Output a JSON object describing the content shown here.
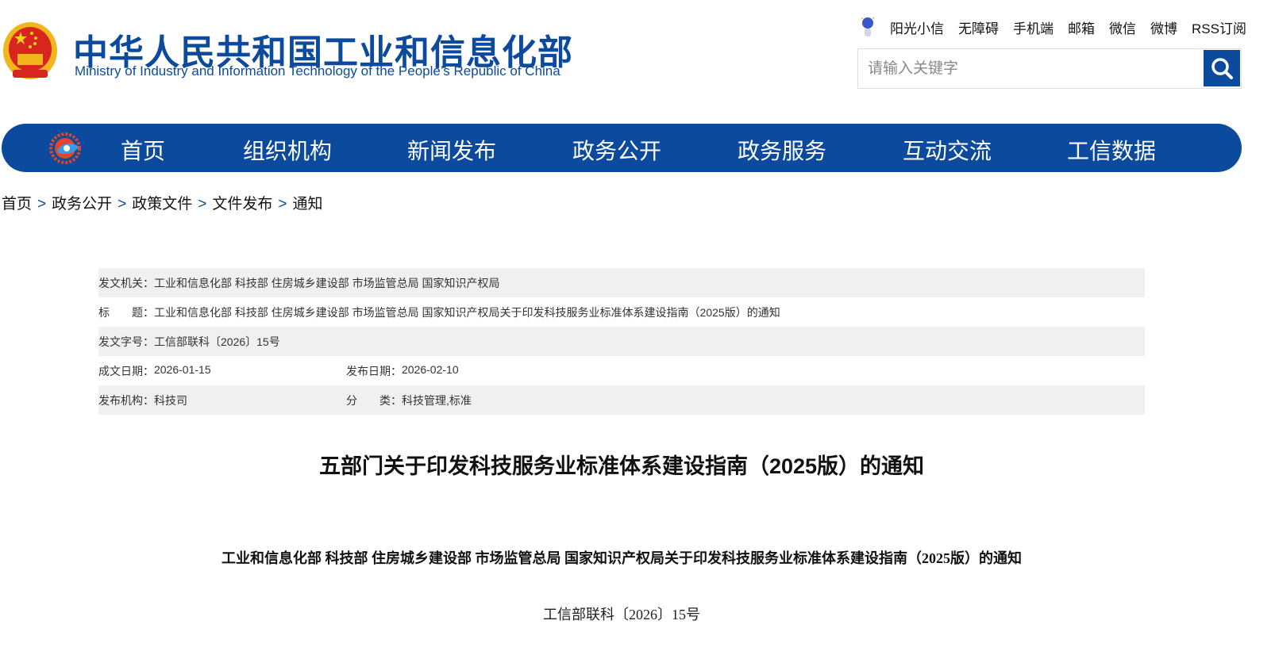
{
  "header": {
    "site_name_cn": "中华人民共和国工业和信息化部",
    "site_name_en": "Ministry of Industry and Information Technology of the People’s Republic of China",
    "top_links": [
      "阳光小信",
      "无障碍",
      "手机端",
      "邮箱",
      "微信",
      "微博",
      "RSS订阅"
    ],
    "search_placeholder": "请输入关键字"
  },
  "nav": {
    "items": [
      "首页",
      "组织机构",
      "新闻发布",
      "政务公开",
      "政务服务",
      "互动交流",
      "工信数据"
    ]
  },
  "breadcrumb": [
    "首页",
    "政务公开",
    "政策文件",
    "文件发布",
    "通知"
  ],
  "breadcrumb_sep": ">",
  "meta": {
    "issuer_label": "发文机关：",
    "issuer": "工业和信息化部 科技部 住房城乡建设部 市场监管总局 国家知识产权局",
    "title_label": "标　　题：",
    "title": "工业和信息化部 科技部 住房城乡建设部 市场监管总局 国家知识产权局关于印发科技服务业标准体系建设指南（2025版）的通知",
    "docno_label": "发文字号：",
    "docno": "工信部联科〔2026〕15号",
    "written_label": "成文日期：",
    "written": "2026-01-15",
    "published_label": "发布日期：",
    "published": "2026-02-10",
    "org_label": "发布机构：",
    "org": "科技司",
    "category_label": "分　　类：",
    "category": "科技管理,标准"
  },
  "article": {
    "title": "五部门关于印发科技服务业标准体系建设指南（2025版）的通知",
    "subtitle": "工业和信息化部 科技部 住房城乡建设部 市场监管总局 国家知识产权局关于印发科技服务业标准体系建设指南（2025版）的通知",
    "doc_number": "工信部联科〔2026〕15号"
  },
  "colors": {
    "brand": "#0b4a9c",
    "meta_bg": "#f0f0f0"
  }
}
